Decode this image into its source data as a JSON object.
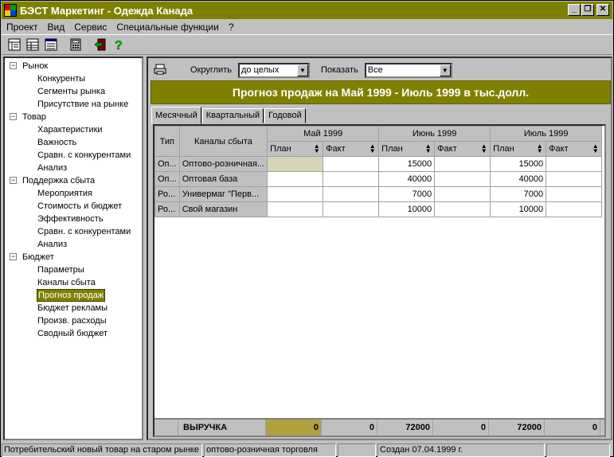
{
  "window": {
    "title": "БЭСТ Маркетинг - Одежда Канада"
  },
  "menu": [
    "Проект",
    "Вид",
    "Сервис",
    "Специальные функции",
    "?"
  ],
  "tree": {
    "groups": [
      {
        "label": "Рынок",
        "items": [
          "Конкуренты",
          "Сегменты рынка",
          "Присутствие на рынке"
        ]
      },
      {
        "label": "Товар",
        "items": [
          "Характеристики",
          "Важность",
          "Сравн. с конкурентами",
          "Анализ"
        ]
      },
      {
        "label": "Поддержка сбыта",
        "items": [
          "Мероприятия",
          "Стоимость и бюджет",
          "Эффективность",
          "Сравн. с конкурентами",
          "Анализ"
        ]
      },
      {
        "label": "Бюджет",
        "items": [
          "Параметры",
          "Каналы сбыта",
          "Прогноз продаж",
          "Бюджет рекламы",
          "Произв. расходы",
          "Сводный бюджет"
        ]
      }
    ],
    "selected": "Прогноз продаж",
    "expand_symbol": "−"
  },
  "controls": {
    "round_label": "Округлить",
    "round_value": "до целых",
    "show_label": "Показать",
    "show_value": "Все"
  },
  "banner": "Прогноз продаж на Май 1999 - Июль 1999 в тыс.долл.",
  "tabs": [
    "Месячный",
    "Квартальный",
    "Годовой"
  ],
  "grid": {
    "col_type": "Тип",
    "col_channel": "Каналы сбыта",
    "months": [
      "Май 1999",
      "Июнь 1999",
      "Июль 1999"
    ],
    "plan": "План",
    "fact": "Факт",
    "rows": [
      {
        "type": "Оп...",
        "channel": "Оптово-розничная...",
        "v": [
          "",
          "",
          "15000",
          "",
          "15000",
          ""
        ]
      },
      {
        "type": "Оп...",
        "channel": "Оптовая база",
        "v": [
          "",
          "",
          "40000",
          "",
          "40000",
          ""
        ]
      },
      {
        "type": "Ро...",
        "channel": "Универмаг \"Перв...",
        "v": [
          "",
          "",
          "7000",
          "",
          "7000",
          ""
        ]
      },
      {
        "type": "Ро...",
        "channel": "Свой магазин",
        "v": [
          "",
          "",
          "10000",
          "",
          "10000",
          ""
        ]
      }
    ],
    "total_label": "ВЫРУЧКА",
    "totals": [
      "0",
      "0",
      "72000",
      "0",
      "72000",
      "0"
    ]
  },
  "status": [
    "Потребительский новый товар на старом рынке",
    "оптово-розничная торговля",
    "",
    "Создан 07.04.1999 г.",
    ""
  ],
  "colors": {
    "accent": "#808000",
    "face": "#c0c0c0"
  }
}
